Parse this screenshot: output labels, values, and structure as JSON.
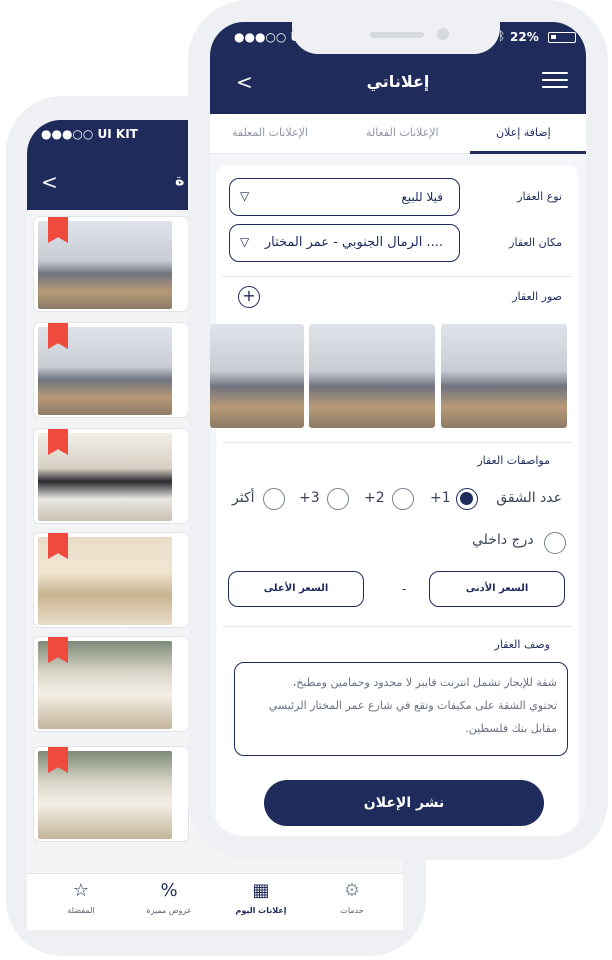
{
  "back_phone": {
    "status": "●●●○○ UI KIT",
    "back_label": "<",
    "title": "ة",
    "tabs": [
      {
        "label": "المفضلة",
        "icon": "star-icon"
      },
      {
        "label": "عروض مميزة",
        "icon": "percent-badge-icon"
      },
      {
        "label": "إعلانات اليوم",
        "icon": "calendar-icon"
      },
      {
        "label": "خدمات",
        "icon": "gear-hand-icon"
      }
    ],
    "bookmark_color": "#ef4a3d"
  },
  "front_phone": {
    "status_left": "●●●○○ UI",
    "status_right": "22%",
    "back_label": "<",
    "title": "إعلاناتي",
    "tabs": [
      {
        "label": "إضافة إعلان",
        "active": true
      },
      {
        "label": "الإعلانات الفعالة",
        "active": false
      },
      {
        "label": "الإعلانات المعلقة",
        "active": false
      }
    ],
    "form": {
      "property_type_label": "نوع العقار",
      "property_type_value": "فيلا للبيع",
      "location_label": "مكان العقار",
      "location_value": "الرمال الجنوبي - عمر المختار ....",
      "photos_label": "صور العقار",
      "add_photo_icon": "plus-icon",
      "specs_label": "مواصفات العقار",
      "rooms_label": "عدد الشقق",
      "room_options": [
        "+1",
        "+2",
        "+3",
        "أكثر"
      ],
      "room_selected": "+1",
      "inner_stairs_label": "درج داخلي",
      "min_price_label": "السعر الأدنى",
      "max_price_label": "السعر الأعلى",
      "dash": "-",
      "description_label": "وصف العقار",
      "description_lines": [
        "شقة للإيجار تشمل انترنت فايبر لا محدود وحمامين ومطبخ،",
        "تحتوي الشقة على  مكيفات وتقع في شارع عمر المختار الرئيسي",
        "مقابل بنك فلسطين."
      ],
      "publish_label": "نشر الإعلان"
    },
    "accent_color": "#1e2b5b"
  }
}
